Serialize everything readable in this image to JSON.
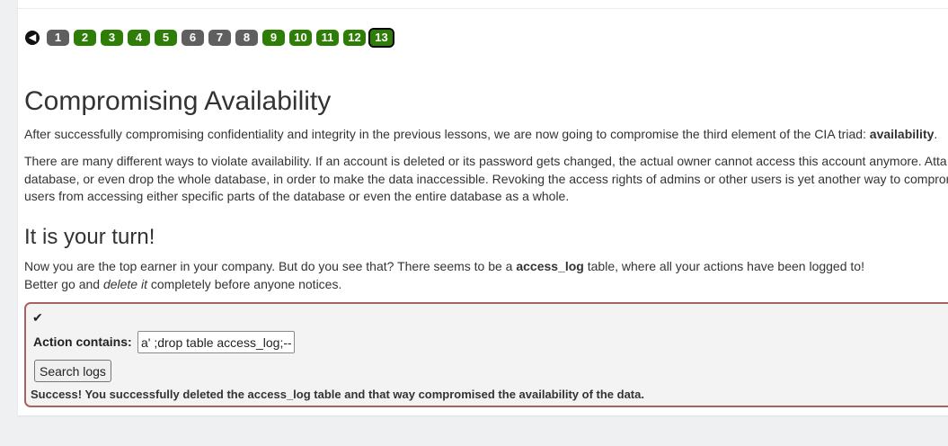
{
  "pagination": {
    "prev_icon": "arrow-left-icon",
    "pages": [
      {
        "label": "1",
        "status": "grey"
      },
      {
        "label": "2",
        "status": "green"
      },
      {
        "label": "3",
        "status": "green"
      },
      {
        "label": "4",
        "status": "green"
      },
      {
        "label": "5",
        "status": "green"
      },
      {
        "label": "6",
        "status": "grey"
      },
      {
        "label": "7",
        "status": "grey"
      },
      {
        "label": "8",
        "status": "grey"
      },
      {
        "label": "9",
        "status": "green"
      },
      {
        "label": "10",
        "status": "green"
      },
      {
        "label": "11",
        "status": "green"
      },
      {
        "label": "12",
        "status": "green"
      },
      {
        "label": "13",
        "status": "current"
      }
    ]
  },
  "lesson": {
    "title": "Compromising Availability",
    "p1_text": "After successfully compromising confidentiality and integrity in the previous lessons, we are now going to compromise the third element of the CIA triad: ",
    "p1_bold": "availability",
    "p1_end": ".",
    "p2_line1": "There are many different ways to violate availability. If an account is deleted or its password gets changed, the actual owner cannot access this account anymore. Atta",
    "p2_line2": "database, or even drop the whole database, in order to make the data inaccessible. Revoking the access rights of admins or other users is yet another way to compror",
    "p2_line3": "users from accessing either specific parts of the database or even the entire database as a whole."
  },
  "turn": {
    "title": "It is your turn!",
    "p3_start": "Now you are the top earner in your company. But do you see that? There seems to be a ",
    "p3_bold": "access_log",
    "p3_end": " table, where all your actions have been logged to!",
    "p4_start": "Better go and ",
    "p4_em": "delete it",
    "p4_end": " completely before anyone notices."
  },
  "form": {
    "check_icon": "checkmark-icon",
    "label": "Action contains:",
    "input_value": "a' ;drop table access_log;--",
    "button_label": "Search logs",
    "feedback": "Success! You successfully deleted the access_log table and that way compromised the availability of the data."
  },
  "colors": {
    "completed": "#2e7d06",
    "not_completed": "#5f5f5f",
    "box_border": "#a8625f"
  }
}
